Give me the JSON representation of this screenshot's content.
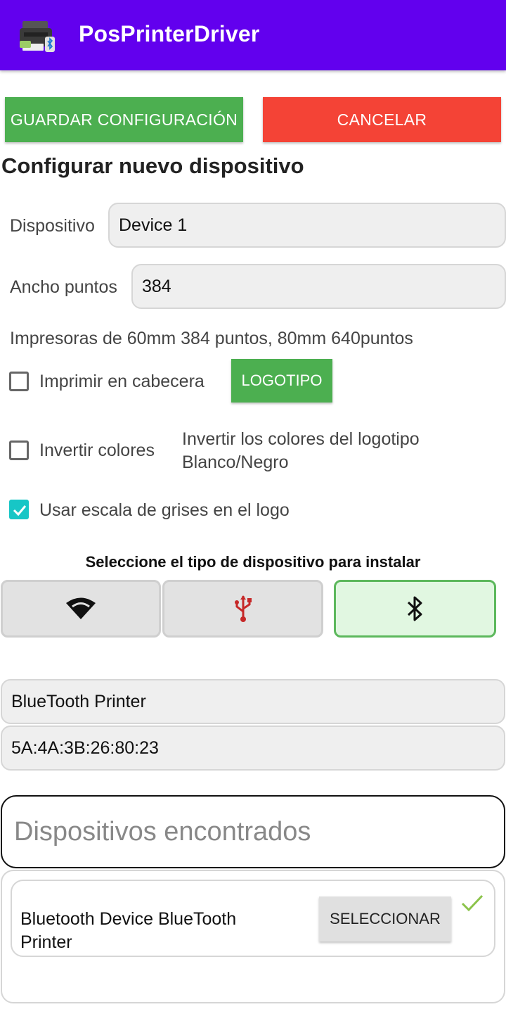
{
  "app": {
    "title": "PosPrinterDriver"
  },
  "actions": {
    "save_label": "GUARDAR CONFIGURACIÓN",
    "cancel_label": "CANCELAR"
  },
  "form": {
    "section_title": "Configurar nuevo dispositivo",
    "device_label": "Dispositivo",
    "device_value": "Device 1",
    "width_label": "Ancho puntos",
    "width_value": "384",
    "width_hint": "Impresoras de 60mm 384 puntos, 80mm 640puntos",
    "print_header_label": "Imprimir en cabecera",
    "print_header_checked": false,
    "logo_button_label": "LOGOTIPO",
    "invert_label": "Invertir colores",
    "invert_checked": false,
    "invert_desc_line1": "Invertir los colores del logotipo",
    "invert_desc_line2": "Blanco/Negro",
    "grayscale_label": "Usar escala de grises en el logo",
    "grayscale_checked": true
  },
  "device_type": {
    "heading": "Seleccione el tipo de dispositivo para instalar",
    "options": [
      {
        "icon": "wifi-icon",
        "selected": false
      },
      {
        "icon": "usb-icon",
        "selected": false
      },
      {
        "icon": "bluetooth-icon",
        "selected": true
      }
    ]
  },
  "selected_device": {
    "name": "BlueTooth Printer",
    "address": "5A:4A:3B:26:80:23"
  },
  "found": {
    "header": "Dispositivos encontrados",
    "items": [
      {
        "name": "Bluetooth Device BlueTooth Printer",
        "button_label": "SELECCIONAR",
        "selected": true
      }
    ]
  },
  "colors": {
    "app_bar": "#6200ee",
    "primary_green": "#4caf50",
    "cancel_red": "#f44336",
    "checkbox_teal": "#17c6c6",
    "usb_icon_red": "#c62828",
    "check_green": "#8bc34a"
  }
}
